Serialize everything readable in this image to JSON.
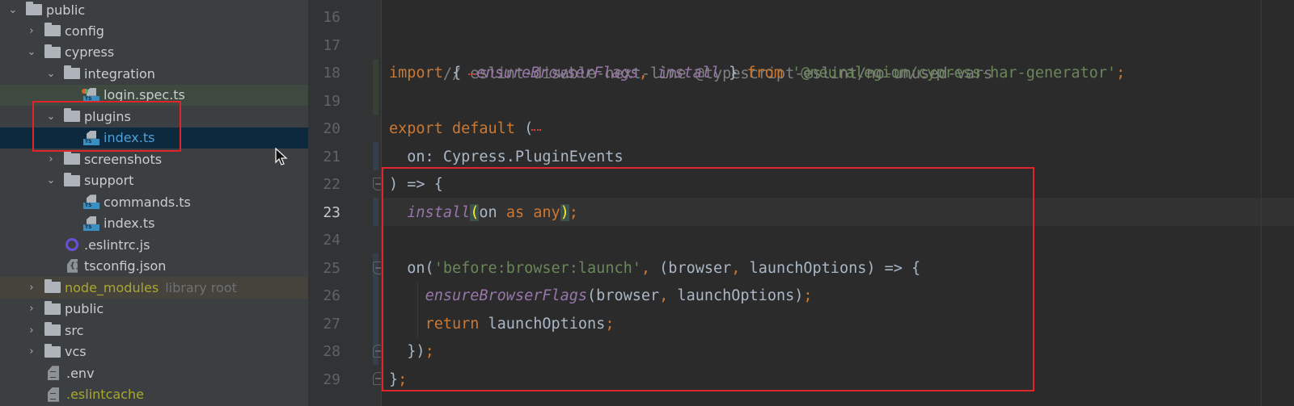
{
  "project_tree": {
    "items": [
      {
        "label": "public",
        "type": "folder",
        "expanded": true
      },
      {
        "label": "config",
        "type": "folder",
        "expanded": false
      },
      {
        "label": "cypress",
        "type": "folder",
        "expanded": true
      },
      {
        "label": "integration",
        "type": "folder",
        "expanded": true
      },
      {
        "label": "login.spec.ts",
        "type": "ts-test-file"
      },
      {
        "label": "plugins",
        "type": "folder",
        "expanded": true
      },
      {
        "label": "index.ts",
        "type": "ts-file",
        "selected": true
      },
      {
        "label": "screenshots",
        "type": "folder",
        "expanded": false
      },
      {
        "label": "support",
        "type": "folder",
        "expanded": true
      },
      {
        "label": "commands.ts",
        "type": "ts-file"
      },
      {
        "label": "index.ts",
        "type": "ts-file"
      },
      {
        "label": ".eslintrc.js",
        "type": "eslint-file"
      },
      {
        "label": "tsconfig.json",
        "type": "json-file"
      },
      {
        "label": "node_modules",
        "type": "folder",
        "expanded": false,
        "suffix": "library root"
      },
      {
        "label": "public",
        "type": "folder",
        "expanded": false
      },
      {
        "label": "src",
        "type": "folder",
        "expanded": false
      },
      {
        "label": "vcs",
        "type": "folder",
        "expanded": false
      },
      {
        "label": ".env",
        "type": "text-file"
      },
      {
        "label": ".eslintcache",
        "type": "text-file"
      }
    ]
  },
  "editor": {
    "current_line": "23",
    "line_numbers": [
      "16",
      "17",
      "18",
      "19",
      "20",
      "21",
      "22",
      "23",
      "24",
      "25",
      "26",
      "27",
      "28",
      "29"
    ],
    "lines": {
      "l17": {
        "comment": "// eslint-disable-next-line @typescript-eslint/no-unused-vars"
      },
      "l18": {
        "kw_import": "import",
        "brace_open": " { ",
        "fn1": "ensureBrowserFlags",
        "comma": ",",
        "sp": " ",
        "fn2": "install",
        "brace_close": " } ",
        "kw_from": "from",
        "sp2": " ",
        "str": "'@neuralegion/cypress-har-generator'",
        "semi": ";"
      },
      "l20": {
        "kw_export": "export",
        "sp": " ",
        "kw_default": "default",
        "paren": " ("
      },
      "l21": {
        "text": "  on: Cypress.PluginEvents"
      },
      "l22": {
        "text": ") => {"
      },
      "l23": {
        "indent": "  ",
        "fn": "install",
        "paren_open": "(",
        "arg": "on ",
        "kw_as": "as",
        "sp": " ",
        "kw_any": "any",
        "paren_close": ")",
        "semi": ";"
      },
      "l25": {
        "indent": "  ",
        "call": "on(",
        "str": "'before:browser:launch'",
        "comma": ",",
        "rest": " (browser",
        "comma2": ",",
        "rest2": " launchOptions) => {"
      },
      "l26": {
        "indent": "    ",
        "fn": "ensureBrowserFlags",
        "args1": "(browser",
        "comma": ",",
        "args2": " launchOptions)",
        "semi": ";"
      },
      "l27": {
        "indent": "    ",
        "kw_return": "return",
        "rest": " launchOptions",
        "semi": ";"
      },
      "l28": {
        "indent": "  ",
        "text": "})",
        "semi": ";"
      },
      "l29": {
        "text": "}",
        "semi": ";"
      }
    }
  },
  "annotations": {
    "highlight_color": "#e0242c"
  }
}
